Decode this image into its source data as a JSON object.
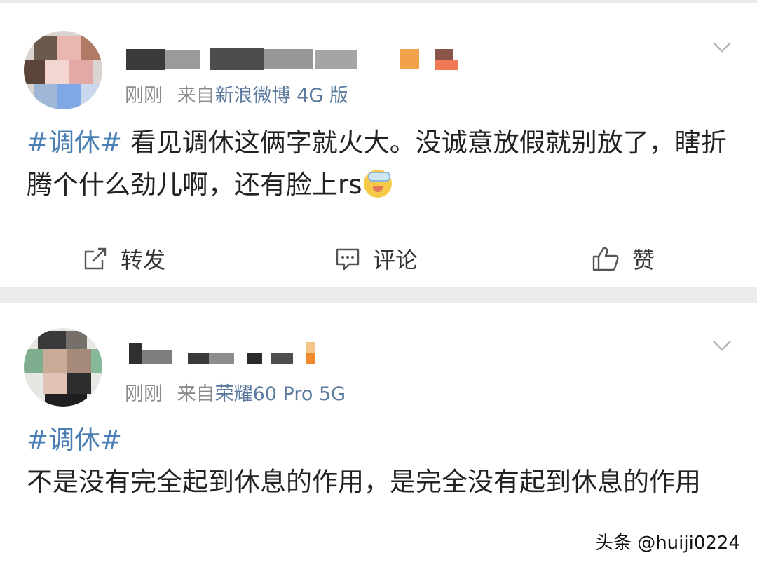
{
  "posts": [
    {
      "time": "刚刚",
      "from_prefix": "来自",
      "source": "新浪微博 4G 版",
      "hashtag": "#调休#",
      "text": "看见调休这俩字就火大。没诚意放假就别放了，瞎折腾个什么劲儿啊，还有脸上rs",
      "actions": {
        "repost": "转发",
        "comment": "评论",
        "like": "赞"
      }
    },
    {
      "time": "刚刚",
      "from_prefix": "来自",
      "source": "荣耀60 Pro 5G",
      "hashtag": "#调休#",
      "text": "不是没有完全起到休息的作用，是完全没有起到休息的作用"
    }
  ],
  "watermark": "头条 @huiji0224",
  "icons": {
    "more": "chevron-down-icon",
    "repost": "repost-icon",
    "comment": "comment-icon",
    "like": "thumbs-up-icon",
    "emoji": "cold-sweat-emoji-icon"
  },
  "colors": {
    "hashtag": "#4a7fb5",
    "source": "#5b7a9e",
    "meta": "#8a8a8a",
    "separator": "#ececec"
  }
}
